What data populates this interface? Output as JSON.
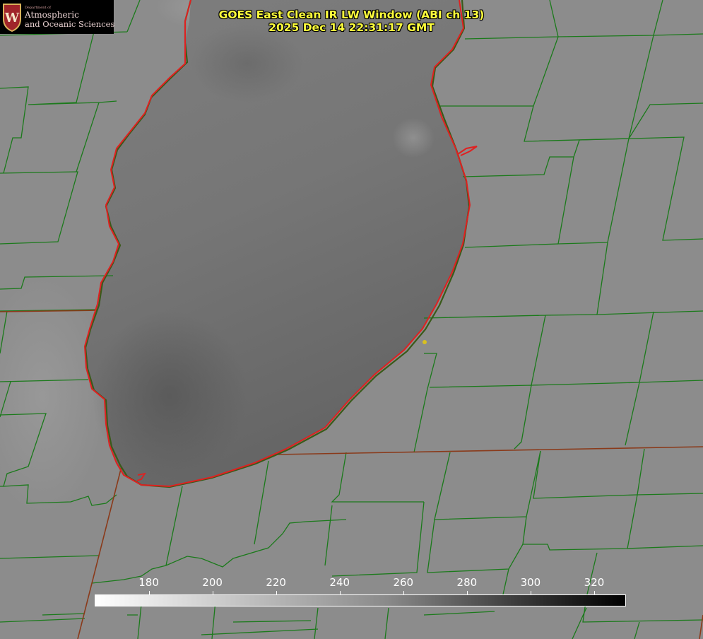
{
  "image": {
    "title_line1": "GOES East Clean IR LW Window (ABI ch 13)",
    "title_line2": "2025 Dec 14 22:31:17 GMT",
    "logo": {
      "dept": "Department of",
      "line1": "Atmospheric",
      "line2": "and Oceanic Sciences",
      "seal_letter": "W"
    }
  },
  "colorbar": {
    "ticks": [
      "180",
      "200",
      "220",
      "240",
      "260",
      "280",
      "300",
      "320"
    ],
    "min": 163,
    "max": 330
  },
  "colors": {
    "coast_red": "#e02020",
    "county_green": "#1b7a1b",
    "state_border": "#8a3a1a",
    "title_yellow": "#ffff3c",
    "marker": "#d8c020"
  }
}
